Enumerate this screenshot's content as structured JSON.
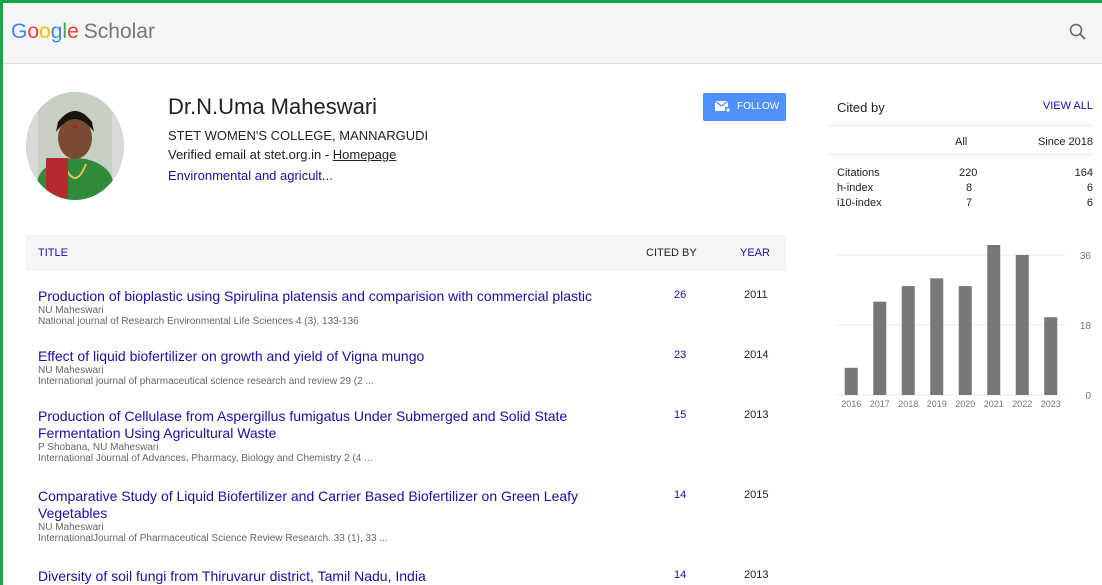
{
  "header": {
    "logo_parts": [
      "G",
      "o",
      "o",
      "g",
      "l",
      "e"
    ],
    "logo_scholar": "Scholar"
  },
  "profile": {
    "name": "Dr.N.Uma Maheswari",
    "affiliation": "STET WOMEN'S COLLEGE, MANNARGUDI",
    "email_text": "Verified email at stet.org.in - ",
    "homepage_label": "Homepage",
    "interests": "Environmental and agricult...",
    "follow_label": "FOLLOW"
  },
  "table": {
    "col_title": "TITLE",
    "col_cited": "CITED BY",
    "col_year": "YEAR",
    "rows": [
      {
        "title": "Production of bioplastic using Spirulina platensis and comparision with commercial plastic",
        "authors": "NU Maheswari",
        "pub": "National journal of Research Environmental Life Sciences 4 (3), 133-136",
        "cited": "26",
        "year": "2011"
      },
      {
        "title": "Effect of liquid biofertilizer on growth and yield of Vigna mungo",
        "authors": "NU Maheswari",
        "pub": "International journal of pharmaceutical science research and review 29 (2 ...",
        "cited": "23",
        "year": "2014"
      },
      {
        "title": "Production of Cellulase from Aspergillus fumigatus Under Submerged and Solid State Fermentation Using Agricultural Waste",
        "authors": "P Shobana, NU Maheswari",
        "pub": "International Journal of Advances, Pharmacy, Biology and Chemistry 2 (4 ...",
        "cited": "15",
        "year": "2013"
      },
      {
        "title": "Comparative Study of Liquid Biofertilizer and Carrier Based Biofertilizer on Green Leafy Vegetables",
        "authors": "NU Maheswari",
        "pub": "InternationalJournal of Pharmaceutical Science Review Research. 33 (1), 33 ...",
        "cited": "14",
        "year": "2015"
      },
      {
        "title": "Diversity of soil fungi from Thiruvarur district, Tamil Nadu, India",
        "authors": "",
        "pub": "",
        "cited": "14",
        "year": "2013"
      }
    ]
  },
  "cited_by": {
    "title": "Cited by",
    "view_all": "VIEW ALL",
    "col_all": "All",
    "col_since": "Since 2018",
    "stats": [
      {
        "label": "Citations",
        "all": "220",
        "since": "164"
      },
      {
        "label": "h-index",
        "all": "8",
        "since": "6"
      },
      {
        "label": "i10-index",
        "all": "7",
        "since": "6"
      }
    ]
  },
  "chart_data": {
    "type": "bar",
    "categories": [
      "2016",
      "2017",
      "2018",
      "2019",
      "2020",
      "2021",
      "2022",
      "2023"
    ],
    "values": [
      7,
      24,
      28,
      30,
      28,
      40,
      36,
      20
    ],
    "ylim": [
      0,
      36
    ],
    "yticks": [
      "36",
      "18",
      "0"
    ],
    "bar_color": "#777777"
  }
}
